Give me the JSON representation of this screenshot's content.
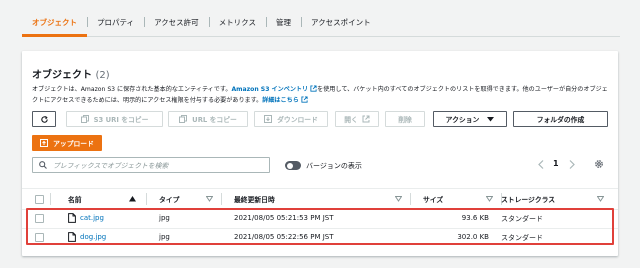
{
  "tabs": [
    "オブジェクト",
    "プロパティ",
    "アクセス許可",
    "メトリクス",
    "管理",
    "アクセスポイント"
  ],
  "panel": {
    "title": "オブジェクト",
    "count": "(2)",
    "desc_part1": "オブジェクトは、Amazon S3 に保存された基本的なエンティティです。",
    "desc_link1": "Amazon S3 インベントリ",
    "desc_part2": "を使用して、バケット内のすべてのオブジェクトのリストを取得できます。他のユーザーが自分のオブジェクトにアクセスできるためには、明示的にアクセス権限を付与する必要があります。",
    "desc_link2": "詳細はこちら"
  },
  "toolbar": {
    "refresh_icon": "refresh-icon",
    "copy_s3_uri": "S3 URI をコピー",
    "copy_url": "URL をコピー",
    "download": "ダウンロード",
    "open": "開く",
    "delete": "削除",
    "actions": "アクション",
    "create_folder": "フォルダの作成",
    "upload": "アップロード"
  },
  "search": {
    "placeholder": "プレフィックスでオブジェクトを検索"
  },
  "versions_label": "バージョンの表示",
  "pagination": {
    "page": "1"
  },
  "table": {
    "headers": {
      "name": "名前",
      "type": "タイプ",
      "modified": "最終更新日時",
      "size": "サイズ",
      "storage": "ストレージクラス"
    },
    "rows": [
      {
        "name": "cat.jpg",
        "type": "jpg",
        "modified": "2021/08/05 05:21:53 PM JST",
        "size": "93.6 KB",
        "storage": "スタンダード"
      },
      {
        "name": "dog.jpg",
        "type": "jpg",
        "modified": "2021/08/05 05:22:56 PM JST",
        "size": "302.0 KB",
        "storage": "スタンダード"
      }
    ]
  },
  "colors": {
    "accent": "#ec7211",
    "link": "#0073bb",
    "highlight": "#e0403a"
  }
}
